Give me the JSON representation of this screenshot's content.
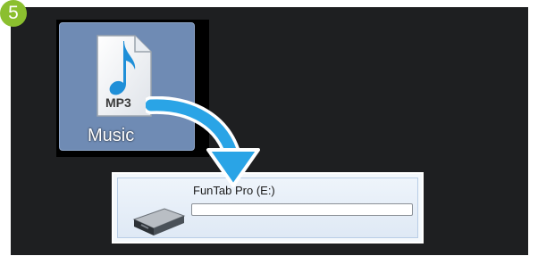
{
  "step": {
    "number": "5"
  },
  "desktop": {
    "music_icon": {
      "label": "Music",
      "file_type": "MP3",
      "icon_name": "mp3-file-icon",
      "selected_color": "#6f8bb4"
    }
  },
  "drive": {
    "name": "FunTab Pro (E:)",
    "icon_name": "removable-drive-icon",
    "usage_fraction": 0.0
  },
  "colors": {
    "badge": "#8bbf2f",
    "arrow": "#2aa4e6",
    "panel_bg": "#1e1f21"
  }
}
